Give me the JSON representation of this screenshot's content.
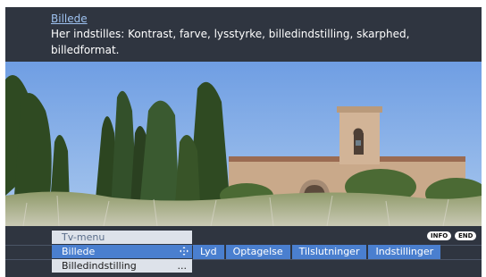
{
  "info": {
    "title": "Billede",
    "description": "Her indstilles: Kontrast, farve, lysstyrke, billedindstilling, skarphed, billedformat."
  },
  "menu": {
    "header": "Tv-menu",
    "items": [
      {
        "label": "Billede",
        "icon": "move-arrows-icon",
        "selected": true
      },
      {
        "label": "Billedindstilling",
        "suffix": "..."
      }
    ]
  },
  "tabs": [
    "Lyd",
    "Optagelse",
    "Tilslutninger",
    "Indstillinger"
  ],
  "keys": {
    "info": "INFO",
    "end": "END"
  },
  "colors": {
    "background": "#2f3540",
    "accent": "#4a7fcf",
    "menu_bg": "#dde2ea",
    "title_link": "#9ec2f0"
  },
  "icons": {
    "selected_item": "move-arrows-icon"
  }
}
